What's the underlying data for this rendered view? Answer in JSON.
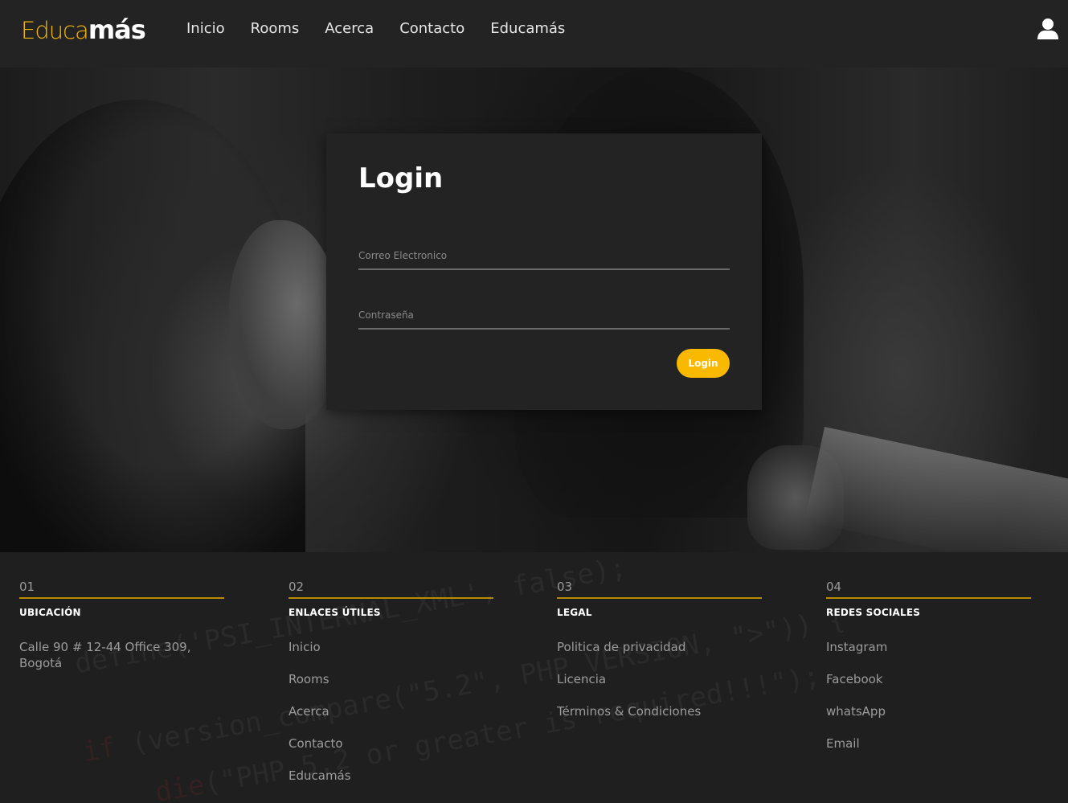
{
  "nav": {
    "logo_part1": "Educa",
    "logo_part2": "más",
    "links": [
      "Inicio",
      "Rooms",
      "Acerca",
      "Contacto",
      "Educamás"
    ],
    "user_icon": "user-icon"
  },
  "login": {
    "title": "Login",
    "email_placeholder": "Correo Electronico",
    "password_placeholder": "Contraseña",
    "button": "Login"
  },
  "footer": {
    "columns": [
      {
        "num": "01",
        "title": "UBICACIÓN",
        "items": [
          "Calle 90 # 12-44 Office 309, Bogotá"
        ]
      },
      {
        "num": "02",
        "title": "ENLACES ÚTILES",
        "items": [
          "Inicio",
          "Rooms",
          "Acerca",
          "Contacto",
          "Educamás"
        ]
      },
      {
        "num": "03",
        "title": "LEGAL",
        "items": [
          "Politica de privacidad",
          "Licencia",
          "Términos & Condiciones"
        ]
      },
      {
        "num": "04",
        "title": "REDES SOCIALES",
        "items": [
          "Instagram",
          "Facebook",
          "whatsApp",
          "Email"
        ]
      }
    ]
  },
  "colors": {
    "accent": "#f9b900",
    "background": "#1f1f1f",
    "card": "#232323"
  }
}
